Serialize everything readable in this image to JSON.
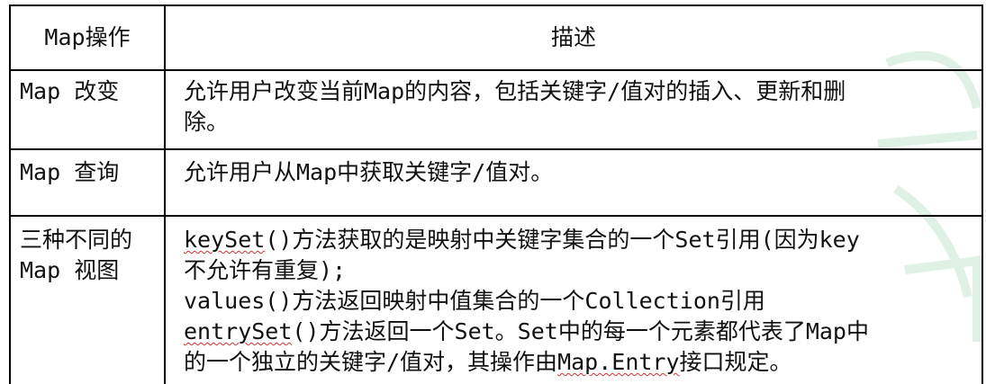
{
  "table": {
    "header": {
      "operation": "Map操作",
      "description": "描述"
    },
    "rows": [
      {
        "operation": "Map 改变",
        "description_lines": [
          "允许用户改变当前Map的内容，包括关键字/值对的插入、更新和删",
          "除。"
        ]
      },
      {
        "operation": "Map 查询",
        "description_lines": [
          "允许用户从Map中获取关键字/值对。"
        ]
      },
      {
        "operation_lines": [
          "三种不同的",
          "Map 视图"
        ],
        "description_parts": {
          "l1_code": "keySet",
          "l1_rest": "()方法获取的是映射中关键字集合的一个Set引用(因为key",
          "l2": "不允许有重复);",
          "l3": "values()方法返回映射中值集合的一个Collection引用",
          "l4_code": "entrySet",
          "l4_rest": "()方法返回一个Set。Set中的每一个元素都代表了Map中",
          "l5_pre": "的一个独立的关键字/值对，其操作由",
          "l5_code": "Map.Entry",
          "l5_post": "接口规定。"
        }
      }
    ]
  },
  "colors": {
    "border": "#000000",
    "text": "#111111",
    "spellcheck": "#d23030",
    "watermark": "#dff0e4"
  }
}
